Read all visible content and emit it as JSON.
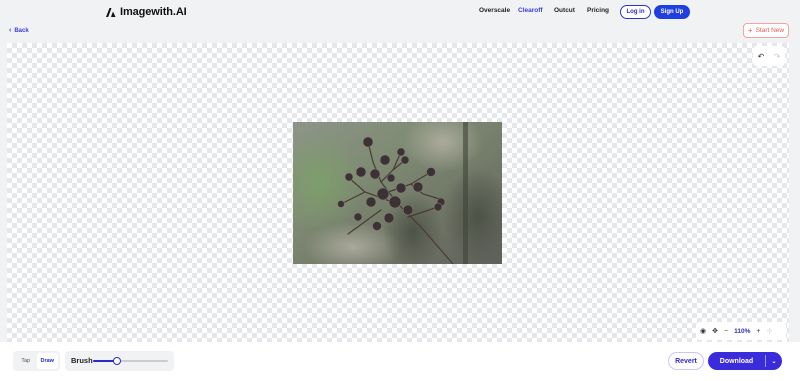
{
  "app": {
    "logo_text": "Imagewith.AI"
  },
  "nav": {
    "items": [
      {
        "label": "Overscale",
        "active": false
      },
      {
        "label": "Clearoff",
        "active": true
      },
      {
        "label": "Outcut",
        "active": false
      },
      {
        "label": "Pricing",
        "active": false
      }
    ],
    "login_label": "Log in",
    "signup_label": "Sign Up"
  },
  "toolbar": {
    "back_label": "Back",
    "start_new_label": "Start New"
  },
  "zoom": {
    "value": "110%"
  },
  "brush": {
    "mode_options": [
      "Tap",
      "Draw"
    ],
    "selected_mode": "Draw",
    "label": "Brush",
    "level": 0.32
  },
  "actions": {
    "revert_label": "Revert",
    "download_label": "Download"
  },
  "colors": {
    "accent": "#3a2bdb",
    "start_new": "#e25a5a"
  },
  "icons": [
    "back-chevron-icon",
    "plus-icon",
    "undo-icon",
    "redo-icon",
    "eye-icon",
    "move-icon",
    "zoom-out-icon",
    "zoom-in-icon",
    "fit-icon",
    "chevron-down-icon"
  ]
}
